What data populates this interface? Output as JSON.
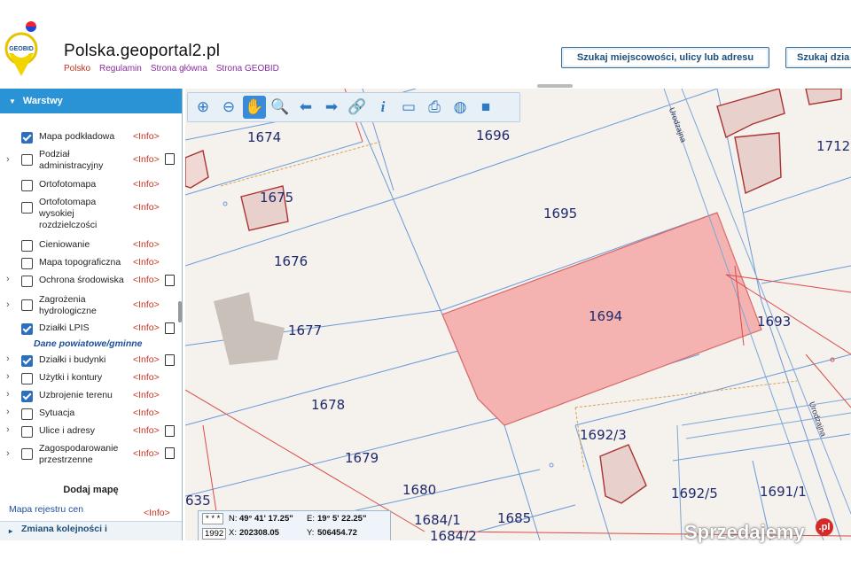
{
  "header": {
    "site_title": "Polska.geoportal2.pl",
    "nav": [
      "Polsko",
      "Regulamin",
      "Strona główna",
      "Strona GEOBID"
    ],
    "logo_text": "GEOBID",
    "search_address_label": "Szukaj miejscowości, ulicy lub adresu",
    "search_parcel_label": "Szukaj dzia"
  },
  "sidebar": {
    "title": "Warstwy",
    "info_label": "<Info>",
    "layers": [
      {
        "label": "Mapa podkładowa",
        "checked": true,
        "expandable": false,
        "doc": false
      },
      {
        "label": "Podział administracyjny",
        "checked": false,
        "expandable": true,
        "doc": true
      },
      {
        "label": "Ortofotomapa",
        "checked": false,
        "expandable": false,
        "doc": false
      },
      {
        "label": "Ortofotomapa wysokiej rozdzielczości",
        "checked": false,
        "expandable": false,
        "doc": false
      },
      {
        "label": "Cieniowanie",
        "checked": false,
        "expandable": false,
        "doc": false
      },
      {
        "label": "Mapa topograficzna",
        "checked": false,
        "expandable": false,
        "doc": false
      },
      {
        "label": "Ochrona środowiska",
        "checked": false,
        "expandable": true,
        "doc": true
      },
      {
        "label": "Zagrożenia hydrologiczne",
        "checked": false,
        "expandable": true,
        "doc": false
      },
      {
        "label": "Działki LPIS",
        "checked": true,
        "expandable": false,
        "doc": true
      }
    ],
    "group_title": "Dane powiatowe/gminne",
    "group_layers": [
      {
        "label": "Działki i budynki",
        "checked": true,
        "expandable": true,
        "doc": true
      },
      {
        "label": "Użytki i kontury",
        "checked": false,
        "expandable": true,
        "doc": false
      },
      {
        "label": "Uzbrojenie terenu",
        "checked": true,
        "expandable": true,
        "doc": false
      },
      {
        "label": "Sytuacja",
        "checked": false,
        "expandable": true,
        "doc": false
      },
      {
        "label": "Ulice i adresy",
        "checked": false,
        "expandable": true,
        "doc": true
      },
      {
        "label": "Zagospodarowanie przestrzenne",
        "checked": false,
        "expandable": true,
        "doc": true
      }
    ],
    "add_map_label": "Dodaj mapę",
    "registry_label": "Mapa rejestru cen nieruchomości",
    "reorder_label": "Zmiana kolejności i"
  },
  "map": {
    "parcels": [
      "1674",
      "1696",
      "1712",
      "1675",
      "1695",
      "1676",
      "1694",
      "1693",
      "1677",
      "1678",
      "1692/3",
      "1679",
      "1680",
      "1692/5",
      "1691/1",
      "1684/1",
      "1685",
      "1684/2",
      "635"
    ],
    "street_label": "Urodzajna",
    "highlight_color": "#f4b3b0",
    "coords": {
      "scale": "* * *",
      "n_label": "N:",
      "n_value": "49° 41' 17.25\"",
      "e_label": "E:",
      "e_value": "19° 5' 22.25\"",
      "epsg": "1992",
      "x_label": "X:",
      "x_value": "202308.05",
      "y_label": "Y:",
      "y_value": "506454.72"
    }
  },
  "watermark": {
    "text": "Sprzedajemy",
    "suffix": ".pl"
  }
}
